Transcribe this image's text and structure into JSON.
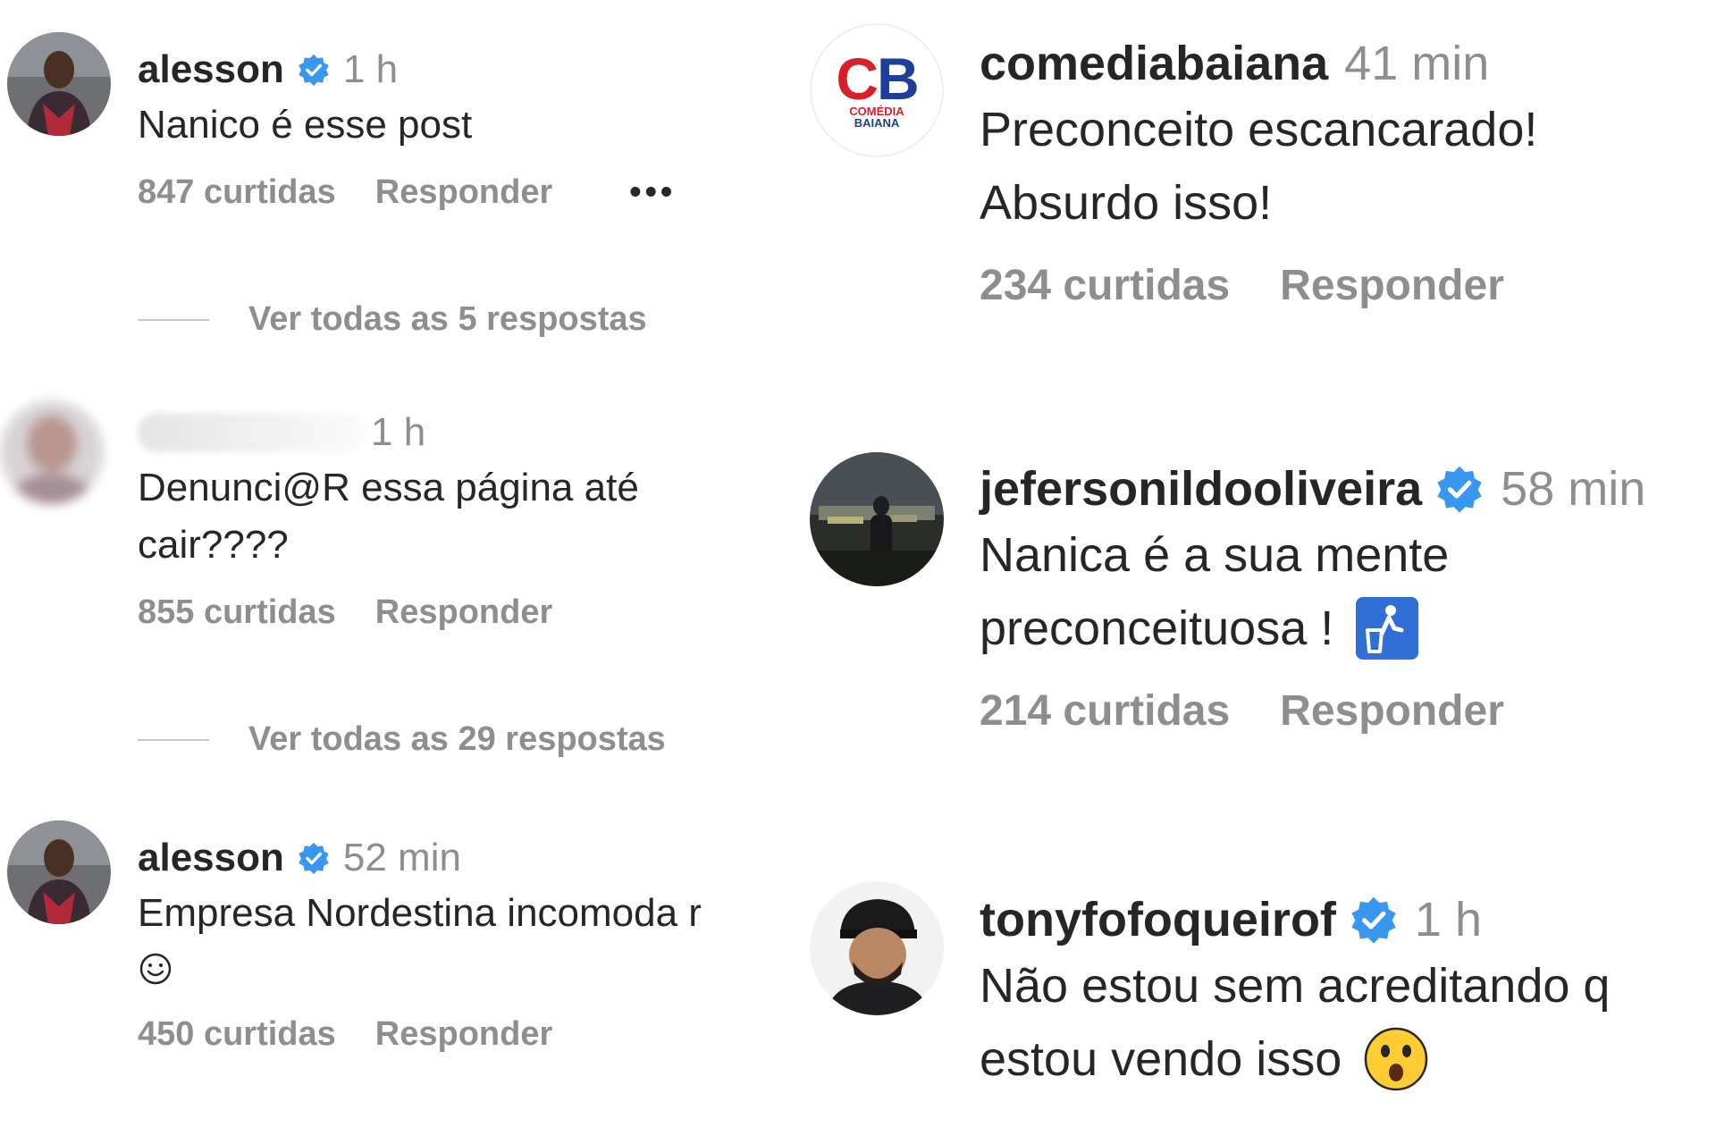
{
  "left_comments": [
    {
      "username": "alesson",
      "verified": true,
      "time": "1 h",
      "text": "Nanico é esse post",
      "likes": "847 curtidas",
      "reply": "Responder",
      "more": "•••",
      "view_replies": "Ver todas as 5 respostas"
    },
    {
      "username": "",
      "verified": false,
      "time": "1 h",
      "text": "Denunci@R essa página até cair????",
      "likes": "855 curtidas",
      "reply": "Responder",
      "view_replies": "Ver todas as 29 respostas"
    },
    {
      "username": "alesson",
      "verified": true,
      "time": "52 min",
      "text": "Empresa Nordestina incomoda r",
      "emoji": "smiley-face-icon",
      "likes": "450 curtidas",
      "reply": "Responder"
    }
  ],
  "right_comments": [
    {
      "username": "comediabaiana",
      "verified": false,
      "time": "41 min",
      "text_line1": "Preconceito escancarado!",
      "text_line2": "Absurdo isso!",
      "likes": "234 curtidas",
      "reply": "Responder",
      "logo": {
        "letters_c": "C",
        "letters_b": "B",
        "sub1": "COMÉDIA",
        "sub2": "BAIANA"
      }
    },
    {
      "username": "jefersonildooliveira",
      "verified": true,
      "time": "58 min",
      "text_line1": "Nanica é a sua mente",
      "text_line2": "preconceituosa !",
      "emoji": "trash-bin-icon",
      "likes": "214 curtidas",
      "reply": "Responder"
    },
    {
      "username": "tonyfofoqueirof",
      "verified": true,
      "time": "1 h",
      "text_line1": "Não estou sem acreditando q",
      "text_line2": "estou vendo isso",
      "emoji": "astonished-face-icon",
      "likes": "",
      "reply": ""
    }
  ],
  "colors": {
    "text": "#262626",
    "muted": "#8e8e8e",
    "verified": "#3897f0",
    "logo_red": "#d8202a",
    "logo_blue": "#1f3e99"
  }
}
